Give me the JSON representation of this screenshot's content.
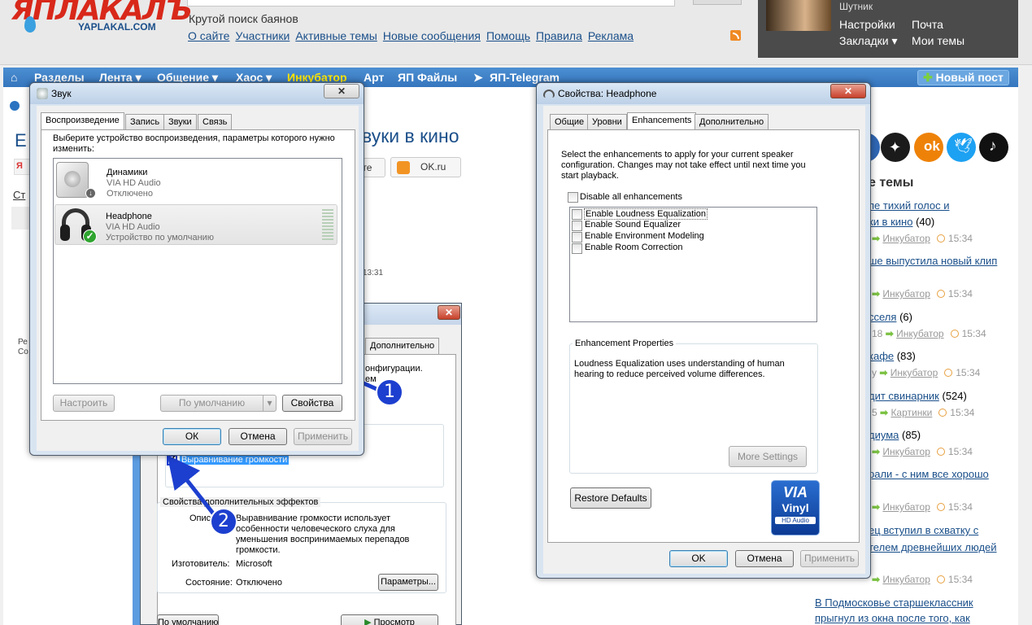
{
  "site": {
    "logo_text": "ЯПЛАКАЛЪ",
    "logo_domain": "YAPLAKAL.COM",
    "tagline": "Крутой поиск баянов",
    "top_links": [
      "О сайте",
      "Участники",
      "Активные темы",
      "Новые сообщения",
      "Помощь",
      "Правила",
      "Реклама"
    ],
    "user": {
      "name": "Шутник",
      "links": [
        "Настройки",
        "Почта",
        "Закладки ▾",
        "Мои темы"
      ]
    },
    "nav": {
      "items": [
        "Разделы",
        "Лента ▾",
        "Общение ▾",
        "Хаос ▾",
        "Инкубатор",
        "Арт",
        "ЯП Файлы",
        "ЯП-Telegram"
      ],
      "new_post": "Новый пост",
      "highlight_color": "#ffe600"
    },
    "page_title_fragment": "вуки в кино",
    "share_vk": "кте",
    "share_ok": "OK.ru",
    "time_fragment": "13:31",
    "left_fragments": [
      "Е",
      "Ст",
      "Ре\nСо"
    ],
    "right_column": {
      "heading": "е темы",
      "items": [
        {
          "text": "пе тихий голос и",
          "text2": "ки в кино",
          "count": "(40)",
          "cat": "Инкубатор",
          "time": "15:34"
        },
        {
          "text": "ше выпустила новый клип",
          "count": "",
          "cat": "Инкубатор",
          "time": "15:34"
        },
        {
          "text": "сселя",
          "count": "(6)",
          "meta_prefix": "18",
          "cat": "Инкубатор",
          "time": "15:34"
        },
        {
          "text": "кафе",
          "count": "(83)",
          "meta_prefix": "у",
          "cat": "Инкубатор",
          "time": "15:34"
        },
        {
          "text": "дит свинарник",
          "count": "(524)",
          "meta_prefix": "5",
          "cat": "Картинки",
          "time": "15:34"
        },
        {
          "text": "диума",
          "count": "(85)",
          "cat": "Инкубатор",
          "time": "15:34"
        },
        {
          "text": "рали - с ним все хорошо",
          "count": "",
          "cat": "Инкубатор",
          "time": "15:34"
        },
        {
          "text": "ец вступил в схватку с",
          "text2": "телем древнейших людей",
          "count": "",
          "cat": "Инкубатор",
          "time": "15:34"
        },
        {
          "text": "В Подмосковье старшеклассник",
          "text2": "прыгнул из окна после того, как",
          "count": ""
        }
      ]
    }
  },
  "sound_dialog": {
    "title": "Звук",
    "tabs": [
      "Воспроизведение",
      "Запись",
      "Звуки",
      "Связь"
    ],
    "instruction": "Выберите устройство воспроизведения, параметры которого нужно изменить:",
    "devices": [
      {
        "name": "Динамики",
        "driver": "VIA HD Audio",
        "status": "Отключено"
      },
      {
        "name": "Headphone",
        "driver": "VIA HD Audio",
        "status": "Устройство по умолчанию"
      }
    ],
    "buttons": {
      "configure": "Настроить",
      "default": "По умолчанию",
      "properties": "Свойства",
      "ok": "ОК",
      "cancel": "Отмена",
      "apply": "Применить"
    }
  },
  "bg_dialog": {
    "tab_fragment": "Дополнительно",
    "text_fragment": "онфигурации.",
    "text_fragment2": "ем",
    "loudness_label": "Выравнивание громкости",
    "effects_group": "Свойства дополнительных эффектов",
    "desc_label": "Описа",
    "desc_text": "Выравнивание громкости использует особенности человеческого слуха для уменьшения воспринимаемых перепадов громкости.",
    "maker_label": "Изготовитель:",
    "maker_value": "Microsoft",
    "state_label": "Состояние:",
    "state_value": "Отключено",
    "params_button": "Параметры...",
    "default_button": "По умолчанию",
    "preview_button": "Просмотр"
  },
  "props_dialog": {
    "title": "Свойства: Headphone",
    "tabs": [
      "Общие",
      "Уровни",
      "Enhancements",
      "Дополнительно"
    ],
    "intro": "Select the enhancements to apply for your current speaker configuration. Changes may not take effect until next time you start playback.",
    "disable_all": "Disable all enhancements",
    "enhancements": [
      "Enable Loudness Equalization",
      "Enable Sound Equalizer",
      "Enable Environment Modeling",
      "Enable Room Correction"
    ],
    "props_group": "Enhancement Properties",
    "props_text": "Loudness Equalization uses understanding of human hearing to reduce perceived volume differences.",
    "more_settings": "More Settings",
    "restore_defaults": "Restore Defaults",
    "via_logo": {
      "brand": "VIA",
      "product": "Vinyl",
      "sub": "HD Audio"
    },
    "buttons": {
      "ok": "OK",
      "cancel": "Отмена",
      "apply": "Применить"
    }
  },
  "annotations": {
    "marker1": "1",
    "marker2": "2"
  }
}
